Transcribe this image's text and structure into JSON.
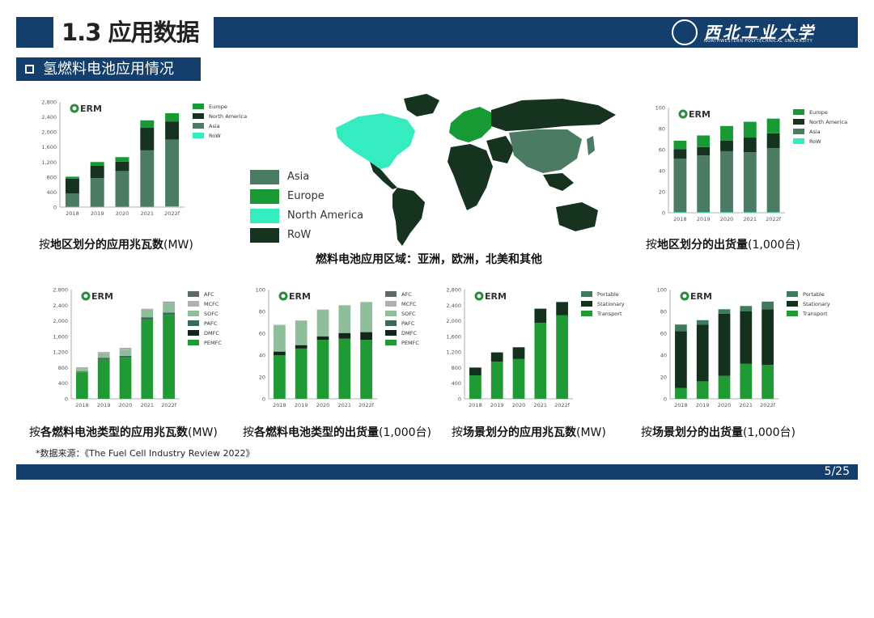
{
  "header": {
    "title": "1.3 应用数据",
    "university_name": "西北工业大学",
    "university_name_en": "NORTHWESTERN POLYTECHNICAL UNIVERSITY"
  },
  "subtitle": "氢燃料电池应用情况",
  "logo_text": "ERM",
  "colors": {
    "navy": "#143f6d",
    "Europe": "#179a34",
    "North America": "#15331f",
    "Asia": "#4c7b64",
    "RoW": "#35ecc0",
    "AFC": "#5f6966",
    "MCFC": "#b1b1b1",
    "SOFC": "#8fbe9a",
    "PAFC": "#3a6a55",
    "DMFC": "#13261b",
    "PEMFC": "#1f9a34",
    "Portable": "#3e7a5d",
    "Stationary": "#14311e",
    "Transport": "#1f9a34"
  },
  "map": {
    "legend": [
      "Asia",
      "Europe",
      "North America",
      "RoW"
    ],
    "legend_colors": [
      "#4c7b64",
      "#179a34",
      "#35ecc0",
      "#15331f"
    ],
    "caption": "燃料电池应用区域：亚洲，欧洲，北美和其他"
  },
  "captions": {
    "c1": {
      "prefix": "按",
      "bold": "地区划分的应用兆瓦数",
      "suffix": "(MW)"
    },
    "c2": {
      "prefix": "按",
      "bold": "地区划分的出货量",
      "suffix": "(1,000台)"
    },
    "c3": {
      "prefix": "按",
      "bold": "各燃料电池类型的应用兆瓦数",
      "suffix": "(MW)"
    },
    "c4": {
      "prefix": "按",
      "bold": "各燃料电池类型的出货量",
      "suffix": "(1,000台)"
    },
    "c5": {
      "prefix": "按",
      "bold": "场景划分的应用兆瓦数",
      "suffix": "(MW)"
    },
    "c6": {
      "prefix": "按",
      "bold": "场景划分的出货量",
      "suffix": "(1,000台)"
    }
  },
  "source": "*数据来源：《The Fuel Cell Industry Review 2022》",
  "page": "5/25",
  "chart_data": [
    {
      "type": "bar",
      "stacked": true,
      "categories": [
        "2018",
        "2019",
        "2020",
        "2021",
        "2022f"
      ],
      "ylim": [
        0,
        2800
      ],
      "yticks": [
        "0",
        "400",
        "800",
        "1,200",
        "1,600",
        "2,000",
        "2,400",
        "2,800"
      ],
      "legend_placement": "top-right",
      "series": [
        {
          "name": "Europe",
          "values": [
            50,
            100,
            120,
            200,
            220
          ]
        },
        {
          "name": "North America",
          "values": [
            400,
            330,
            250,
            600,
            480
          ]
        },
        {
          "name": "Asia",
          "values": [
            350,
            760,
            950,
            1500,
            1780
          ]
        },
        {
          "name": "RoW",
          "values": [
            10,
            10,
            10,
            10,
            20
          ]
        }
      ]
    },
    {
      "type": "bar",
      "stacked": true,
      "categories": [
        "2018",
        "2019",
        "2020",
        "2021",
        "2022f"
      ],
      "ylim": [
        0,
        100
      ],
      "yticks": [
        "0",
        "20",
        "40",
        "60",
        "80",
        "100"
      ],
      "legend_placement": "top-right",
      "series": [
        {
          "name": "Europe",
          "values": [
            8,
            11,
            14,
            15,
            14
          ]
        },
        {
          "name": "North America",
          "values": [
            9,
            8,
            10,
            14,
            14
          ]
        },
        {
          "name": "Asia",
          "values": [
            51,
            54,
            58,
            57,
            61
          ]
        },
        {
          "name": "RoW",
          "values": [
            0.5,
            0.5,
            0.5,
            0.5,
            0.5
          ]
        }
      ]
    },
    {
      "type": "bar",
      "stacked": true,
      "categories": [
        "2018",
        "2019",
        "2020",
        "2021",
        "2022f"
      ],
      "ylim": [
        0,
        2800
      ],
      "yticks": [
        "0",
        "400",
        "800",
        "1,200",
        "1,600",
        "2,000",
        "2,400",
        "2,800"
      ],
      "legend_placement": "top-right",
      "series": [
        {
          "name": "AFC",
          "values": [
            5,
            5,
            5,
            5,
            10
          ]
        },
        {
          "name": "MCFC",
          "values": [
            40,
            40,
            40,
            20,
            20
          ]
        },
        {
          "name": "SOFC",
          "values": [
            60,
            100,
            160,
            190,
            250
          ]
        },
        {
          "name": "PAFC",
          "values": [
            20,
            50,
            50,
            60,
            60
          ]
        },
        {
          "name": "DMFC",
          "values": [
            1,
            1,
            1,
            1,
            1
          ]
        },
        {
          "name": "PEMFC",
          "values": [
            680,
            1000,
            1050,
            2030,
            2150
          ]
        }
      ]
    },
    {
      "type": "bar",
      "stacked": true,
      "categories": [
        "2018",
        "2019",
        "2020",
        "2021",
        "2022f"
      ],
      "ylim": [
        0,
        100
      ],
      "yticks": [
        "0",
        "20",
        "40",
        "60",
        "80",
        "100"
      ],
      "legend_placement": "top-right",
      "series": [
        {
          "name": "AFC",
          "values": [
            0.2,
            0.2,
            0.2,
            0.2,
            0.2
          ]
        },
        {
          "name": "MCFC",
          "values": [
            0.1,
            0.1,
            0.1,
            0.1,
            0.1
          ]
        },
        {
          "name": "SOFC",
          "values": [
            24,
            22,
            24,
            25,
            27
          ]
        },
        {
          "name": "PAFC",
          "values": [
            0.3,
            0.3,
            0.3,
            0.3,
            0.3
          ]
        },
        {
          "name": "DMFC",
          "values": [
            3,
            3,
            3,
            5,
            7
          ]
        },
        {
          "name": "PEMFC",
          "values": [
            40,
            46,
            54,
            55,
            54
          ]
        }
      ]
    },
    {
      "type": "bar",
      "stacked": true,
      "categories": [
        "2018",
        "2019",
        "2020",
        "2021",
        "2022f"
      ],
      "ylim": [
        0,
        2800
      ],
      "yticks": [
        "0",
        "400",
        "800",
        "1,200",
        "1,600",
        "2,000",
        "2,400",
        "2,800"
      ],
      "legend_placement": "top-right",
      "series": [
        {
          "name": "Portable",
          "values": [
            2,
            2,
            2,
            2,
            2
          ]
        },
        {
          "name": "Stationary",
          "values": [
            200,
            240,
            300,
            360,
            340
          ]
        },
        {
          "name": "Transport",
          "values": [
            600,
            950,
            1020,
            1950,
            2140
          ]
        }
      ]
    },
    {
      "type": "bar",
      "stacked": true,
      "categories": [
        "2018",
        "2019",
        "2020",
        "2021",
        "2022f"
      ],
      "ylim": [
        0,
        100
      ],
      "yticks": [
        "0",
        "20",
        "40",
        "60",
        "80",
        "100"
      ],
      "legend_placement": "top-right",
      "series": [
        {
          "name": "Portable",
          "values": [
            6,
            4,
            4,
            5,
            7
          ]
        },
        {
          "name": "Stationary",
          "values": [
            52,
            52,
            57,
            48,
            51
          ]
        },
        {
          "name": "Transport",
          "values": [
            10,
            16,
            21,
            32,
            31
          ]
        }
      ]
    }
  ]
}
